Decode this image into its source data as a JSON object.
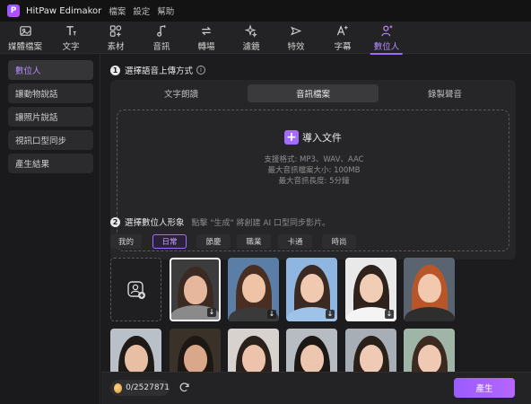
{
  "app": {
    "title": "HitPaw Edimakor",
    "logo_text": "P",
    "menu": [
      "檔案",
      "設定",
      "幫助"
    ]
  },
  "toolbar": {
    "items": [
      {
        "label": "媒體檔案",
        "icon": "media-icon"
      },
      {
        "label": "文字",
        "icon": "text-icon"
      },
      {
        "label": "素材",
        "icon": "elements-icon"
      },
      {
        "label": "音訊",
        "icon": "audio-icon"
      },
      {
        "label": "轉場",
        "icon": "transition-icon"
      },
      {
        "label": "濾鏡",
        "icon": "filter-icon"
      },
      {
        "label": "特效",
        "icon": "effects-icon"
      },
      {
        "label": "字幕",
        "icon": "subtitle-icon"
      },
      {
        "label": "數位人",
        "icon": "digital-human-icon"
      }
    ],
    "active": "數位人"
  },
  "sidebar": {
    "items": [
      {
        "label": "數位人"
      },
      {
        "label": "讓動物說話"
      },
      {
        "label": "讓照片說話"
      },
      {
        "label": "視訊口型同步"
      },
      {
        "label": "產生結果"
      }
    ],
    "active": "數位人"
  },
  "section1": {
    "number": "1",
    "title": "選擇語音上傳方式",
    "tabs": [
      {
        "label": "文字朗讀"
      },
      {
        "label": "音訊檔案"
      },
      {
        "label": "錄製聲音"
      }
    ],
    "active_tab": "音訊檔案",
    "import_label": "導入文件",
    "formats": "支援格式: MP3、WAV、AAC",
    "max_size": "最大音訊檔案大小: 100MB",
    "max_length": "最大音訊長度: 5分鐘"
  },
  "section2": {
    "number": "2",
    "title": "選擇數位人形象",
    "hint": "點擊 \"生成\" 將創建 AI 口型同步影片。",
    "categories": [
      {
        "label": "我的"
      },
      {
        "label": "日常"
      },
      {
        "label": "節慶"
      },
      {
        "label": "職業"
      },
      {
        "label": "卡通"
      },
      {
        "label": "時尚"
      }
    ],
    "active_category": "日常",
    "avatars": [
      {
        "bg": "#3c3c3c",
        "skin": "#e6b79c",
        "hair": "#3a2a22",
        "cloth": "#8a8a8a",
        "selected": true,
        "download": true
      },
      {
        "bg": "#5a7ea6",
        "skin": "#efc3a6",
        "hair": "#4a2e22",
        "cloth": "#3a3a3a",
        "download": true
      },
      {
        "bg": "#8fb6e0",
        "skin": "#f0c9b0",
        "hair": "#3b2a22",
        "cloth": "#9fc3e8",
        "download": true
      },
      {
        "bg": "#e9e9ea",
        "skin": "#f1cdb6",
        "hair": "#2e221c",
        "cloth": "#f4f4f4",
        "download": true
      },
      {
        "bg": "#5a6470",
        "skin": "#f2c8ae",
        "hair": "#b8562a",
        "cloth": "#2e2e2e"
      },
      {
        "bg": "#b9c0c8",
        "skin": "#e8bfa2",
        "hair": "#1e1a18",
        "cloth": "#3a3a3a"
      },
      {
        "bg": "#3a3228",
        "skin": "#d9a88a",
        "hair": "#1e1814",
        "cloth": "#2a2a2a"
      },
      {
        "bg": "#d8d2cf",
        "skin": "#edc4ab",
        "hair": "#2a201c",
        "cloth": "#e0d8d2"
      },
      {
        "bg": "#b6bcc2",
        "skin": "#ecc6ae",
        "hair": "#1c1816",
        "cloth": "#d2d2d2"
      },
      {
        "bg": "#a8aeb5",
        "skin": "#efcab4",
        "hair": "#2a201a",
        "cloth": "#e4e4e4"
      },
      {
        "bg": "#9fb5a8",
        "skin": "#efc9b2",
        "hair": "#3a2a20",
        "cloth": "#c7d6cc"
      }
    ]
  },
  "footer": {
    "credits": "0/2527871",
    "generate_label": "產生"
  }
}
